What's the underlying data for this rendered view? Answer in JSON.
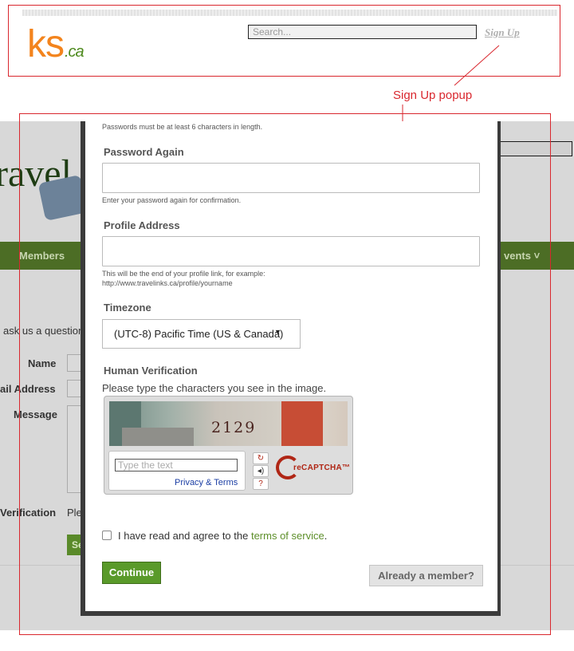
{
  "header": {
    "logo_main": "ks",
    "logo_suffix": ".ca",
    "search_placeholder": "Search...",
    "signup_link": "Sign Up"
  },
  "annotation": {
    "label": "Sign Up popup"
  },
  "background_page": {
    "logo_text": "ravel",
    "nav": {
      "members": "Members",
      "events": "vents ˅"
    },
    "contact_intro": "ask us a question",
    "fields": {
      "name": "Name",
      "email": "ail Address",
      "message": "Message",
      "verification": "Verification",
      "verification_partial": "Ple"
    },
    "send_partial": "Se"
  },
  "modal": {
    "password_hint": "Passwords must be at least 6 characters in length.",
    "password_again_label": "Password Again",
    "password_again_hint": "Enter your password again for confirmation.",
    "profile_address_label": "Profile Address",
    "profile_address_hint_1": "This will be the end of your profile link, for example:",
    "profile_address_hint_2": "http://www.travelinks.ca/profile/yourname",
    "timezone_label": "Timezone",
    "timezone_value": "(UTC-8) Pacific Time (US & Canada)",
    "human_verification_label": "Human Verification",
    "verification_instruction": "Please type the characters you see in the image.",
    "captcha": {
      "image_text": "2129",
      "input_placeholder": "Type the text",
      "privacy_terms": "Privacy & Terms",
      "refresh_icon": "↻",
      "audio_icon": "◂)",
      "help_icon": "?",
      "brand": "reCAPTCHA™"
    },
    "agree_text": "I have read and agree to the ",
    "terms_link": "terms of service",
    "agree_end": ".",
    "continue_button": "Continue",
    "member_button": "Already a member?"
  }
}
